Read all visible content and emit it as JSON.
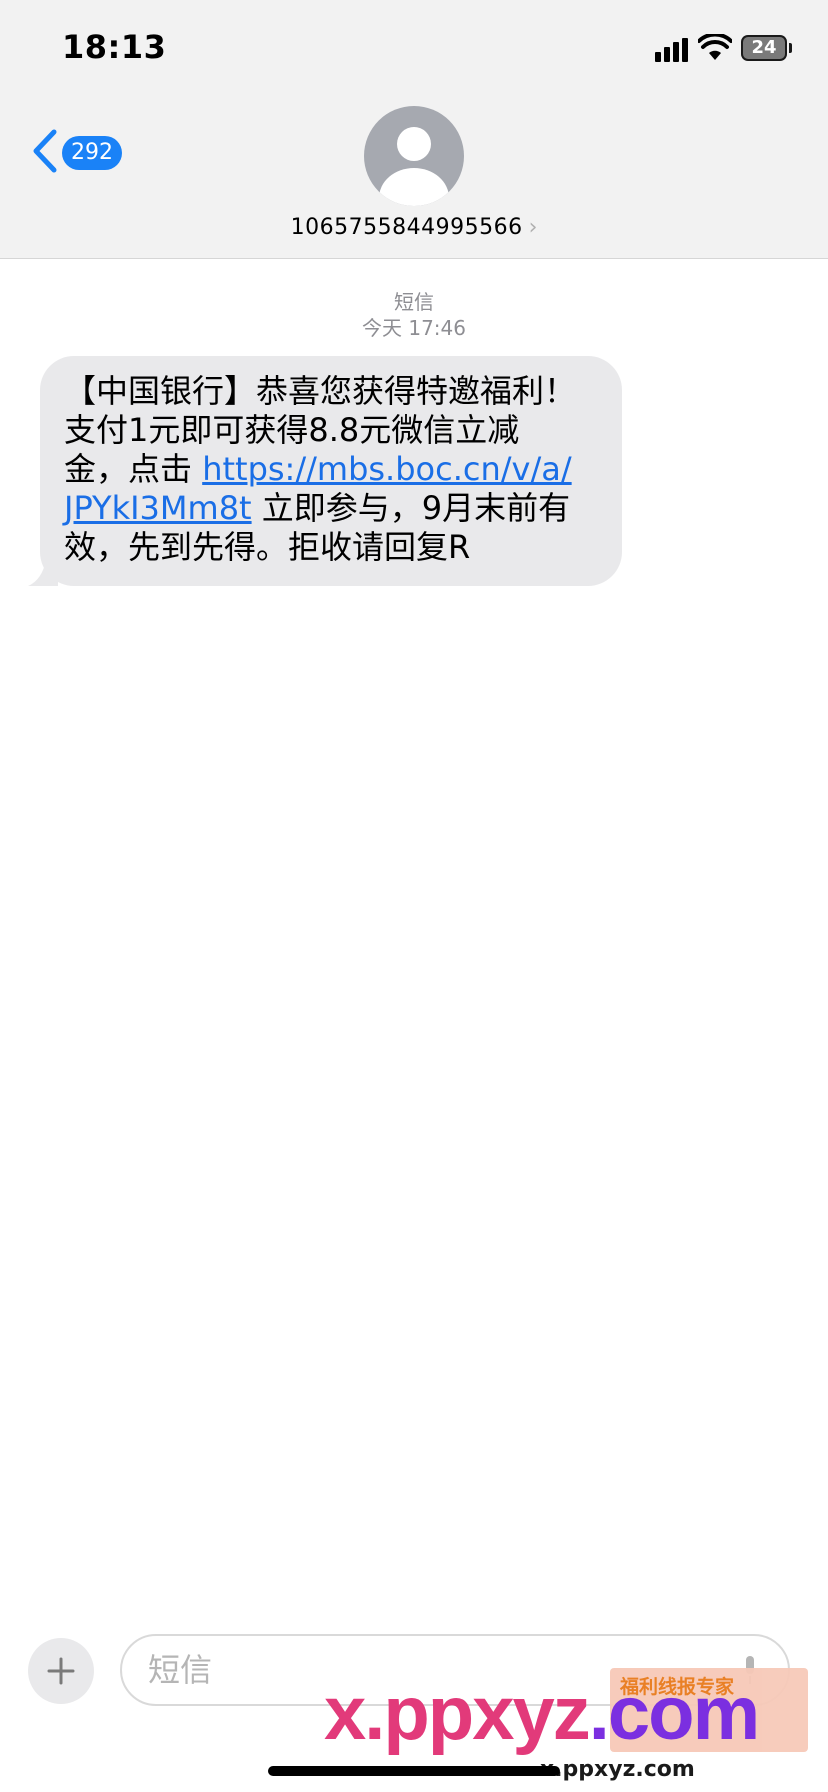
{
  "status_bar": {
    "time": "18:13",
    "battery": "24"
  },
  "header": {
    "back_count": "292",
    "contact_number": "1065755844995566",
    "contact_chevron": "›"
  },
  "thread": {
    "service_label": "短信",
    "timestamp": "今天 17:46",
    "message": {
      "line1": "【中国银行】恭喜您获得特邀福利！",
      "line2": "支付1元即可获得8.8元微信立减",
      "line3_prefix": "金，点击 ",
      "link_part1": "https://mbs.boc.cn/v/a/",
      "link_part2": "JPYkI3Mm8t",
      "line4_suffix": " 立即参与，9月末前有",
      "line5": "效，先到先得。拒收请回复R"
    }
  },
  "composer": {
    "placeholder": "短信"
  },
  "watermark": {
    "logo_main": "x.ppxyz",
    "logo_tail": ".com",
    "badge_text": "福利线报专家",
    "url": "x.ppxyz.com"
  },
  "icons": [
    "back-chevron-icon",
    "contact-avatar-icon",
    "plus-icon",
    "mic-icon",
    "signal-icon",
    "wifi-icon",
    "battery-icon"
  ],
  "colors": {
    "accent_blue": "#1a82f7",
    "link_blue": "#1a6ee6",
    "bubble_gray": "#e9e9eb",
    "header_bg": "#f2f2f2"
  }
}
